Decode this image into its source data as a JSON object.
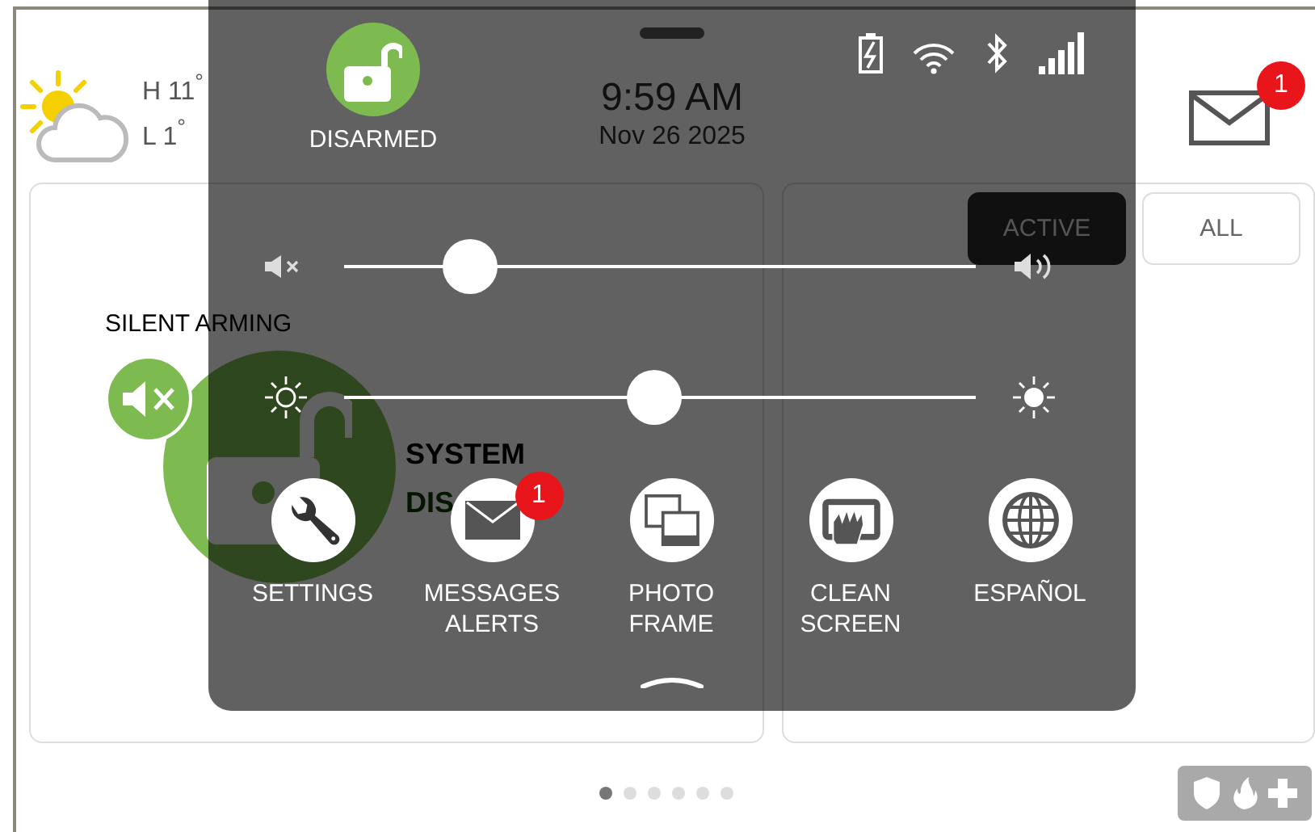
{
  "weather": {
    "high": "H 11$^{°}$",
    "low": "L 1$^{°}$"
  },
  "messages_badge": "1",
  "arming": {
    "silent_label": "SILENT ARMING",
    "system_label": "SYSTEM",
    "system_status": "DIS"
  },
  "filter_tabs": [
    {
      "label": "ACTIVE",
      "selected": true
    },
    {
      "label": "ALL",
      "selected": false
    }
  ],
  "page_dots": [
    {
      "selected": true
    },
    {
      "selected": false
    },
    {
      "selected": false
    },
    {
      "selected": false
    },
    {
      "selected": false
    },
    {
      "selected": false
    }
  ],
  "shade": {
    "status_label": "DISARMED",
    "time": "9:59 AM",
    "date": "Nov 26 2025",
    "sliders": [
      {
        "kind": "volume",
        "level": 0.2
      },
      {
        "kind": "brightness",
        "level": 0.49
      }
    ],
    "shortcuts": [
      {
        "kind": "settings",
        "label": "SETTINGS"
      },
      {
        "kind": "messages",
        "label": "MESSAGES ALERTS",
        "badge": "1"
      },
      {
        "kind": "photo",
        "label": "PHOTO FRAME"
      },
      {
        "kind": "clean",
        "label": "CLEAN SCREEN"
      },
      {
        "kind": "language",
        "label": "ESPAÑOL"
      }
    ]
  }
}
